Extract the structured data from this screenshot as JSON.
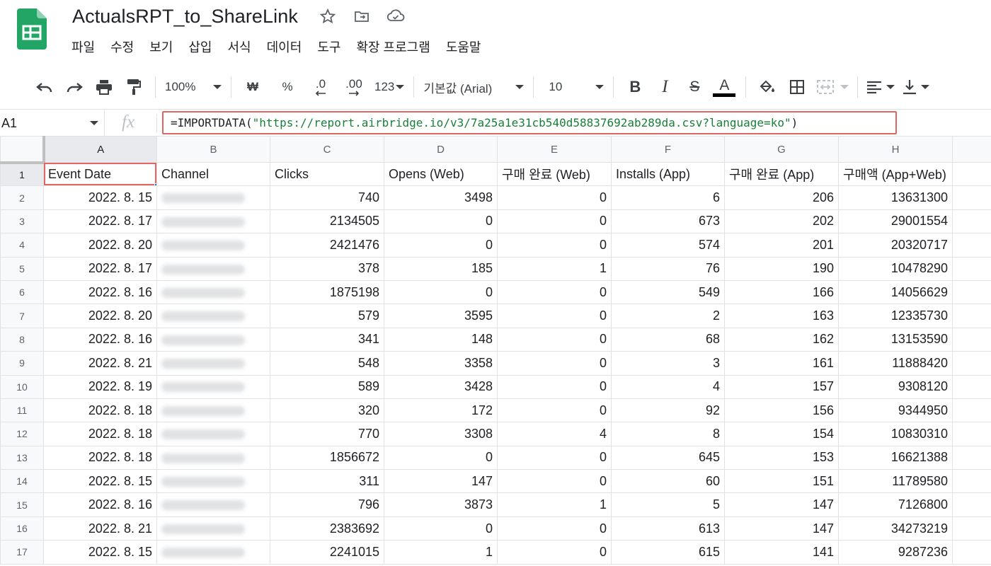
{
  "doc": {
    "title": "ActualsRPT_to_ShareLink"
  },
  "menu": [
    "파일",
    "수정",
    "보기",
    "삽입",
    "서식",
    "데이터",
    "도구",
    "확장 프로그램",
    "도움말"
  ],
  "toolbar": {
    "zoom": "100%",
    "currency": "₩",
    "percent": "%",
    "decrease_decimal": ".0",
    "increase_decimal": ".00",
    "more_formats": "123",
    "font": "기본값 (Arial)",
    "font_size": "10",
    "bold": "B",
    "italic": "I",
    "strike": "S",
    "text_color_letter": "A",
    "accent": "#000000"
  },
  "formula_bar": {
    "name_box": "A1",
    "fx": "fx",
    "formula_prefix": "=IMPORTDATA(",
    "formula_url": "\"https://report.airbridge.io/v3/7a25a1e31cb540d58837692ab289da.csv?language=ko\"",
    "formula_suffix": ")"
  },
  "columns": [
    "A",
    "B",
    "C",
    "D",
    "E",
    "F",
    "G",
    "H"
  ],
  "header_row": {
    "num": "1",
    "cells": [
      "Event Date",
      "Channel",
      "Clicks",
      "Opens (Web)",
      "구매 완료 (Web)",
      "Installs (App)",
      "구매 완료 (App)",
      "구매액 (App+Web)"
    ]
  },
  "rows": [
    {
      "num": "2",
      "date": "2022. 8. 15",
      "clicks": "740",
      "opens_web": "3498",
      "purchase_web": "0",
      "installs_app": "6",
      "purchase_app": "206",
      "revenue": "13631300"
    },
    {
      "num": "3",
      "date": "2022. 8. 17",
      "clicks": "2134505",
      "opens_web": "0",
      "purchase_web": "0",
      "installs_app": "673",
      "purchase_app": "202",
      "revenue": "29001554"
    },
    {
      "num": "4",
      "date": "2022. 8. 20",
      "clicks": "2421476",
      "opens_web": "0",
      "purchase_web": "0",
      "installs_app": "574",
      "purchase_app": "201",
      "revenue": "20320717"
    },
    {
      "num": "5",
      "date": "2022. 8. 17",
      "clicks": "378",
      "opens_web": "185",
      "purchase_web": "1",
      "installs_app": "76",
      "purchase_app": "190",
      "revenue": "10478290"
    },
    {
      "num": "6",
      "date": "2022. 8. 16",
      "clicks": "1875198",
      "opens_web": "0",
      "purchase_web": "0",
      "installs_app": "549",
      "purchase_app": "166",
      "revenue": "14056629"
    },
    {
      "num": "7",
      "date": "2022. 8. 20",
      "clicks": "579",
      "opens_web": "3595",
      "purchase_web": "0",
      "installs_app": "2",
      "purchase_app": "163",
      "revenue": "12335730"
    },
    {
      "num": "8",
      "date": "2022. 8. 16",
      "clicks": "341",
      "opens_web": "148",
      "purchase_web": "0",
      "installs_app": "68",
      "purchase_app": "162",
      "revenue": "13153590"
    },
    {
      "num": "9",
      "date": "2022. 8. 21",
      "clicks": "548",
      "opens_web": "3358",
      "purchase_web": "0",
      "installs_app": "3",
      "purchase_app": "161",
      "revenue": "11888420"
    },
    {
      "num": "10",
      "date": "2022. 8. 19",
      "clicks": "589",
      "opens_web": "3428",
      "purchase_web": "0",
      "installs_app": "4",
      "purchase_app": "157",
      "revenue": "9308120"
    },
    {
      "num": "11",
      "date": "2022. 8. 18",
      "clicks": "320",
      "opens_web": "172",
      "purchase_web": "0",
      "installs_app": "92",
      "purchase_app": "156",
      "revenue": "9344950"
    },
    {
      "num": "12",
      "date": "2022. 8. 18",
      "clicks": "770",
      "opens_web": "3308",
      "purchase_web": "4",
      "installs_app": "8",
      "purchase_app": "154",
      "revenue": "10830310"
    },
    {
      "num": "13",
      "date": "2022. 8. 18",
      "clicks": "1856672",
      "opens_web": "0",
      "purchase_web": "0",
      "installs_app": "645",
      "purchase_app": "153",
      "revenue": "16621388"
    },
    {
      "num": "14",
      "date": "2022. 8. 15",
      "clicks": "311",
      "opens_web": "147",
      "purchase_web": "0",
      "installs_app": "60",
      "purchase_app": "151",
      "revenue": "11789580"
    },
    {
      "num": "15",
      "date": "2022. 8. 16",
      "clicks": "796",
      "opens_web": "3873",
      "purchase_web": "1",
      "installs_app": "5",
      "purchase_app": "147",
      "revenue": "7126800"
    },
    {
      "num": "16",
      "date": "2022. 8. 21",
      "clicks": "2383692",
      "opens_web": "0",
      "purchase_web": "0",
      "installs_app": "613",
      "purchase_app": "147",
      "revenue": "34273219"
    },
    {
      "num": "17",
      "date": "2022. 8. 15",
      "clicks": "2241015",
      "opens_web": "1",
      "purchase_web": "0",
      "installs_app": "615",
      "purchase_app": "141",
      "revenue": "9287236"
    }
  ],
  "colors": {
    "sheets_green": "#23a566",
    "highlight_red": "#e06666",
    "formula_string": "#188038",
    "selection_blue": "#1a73e8"
  }
}
